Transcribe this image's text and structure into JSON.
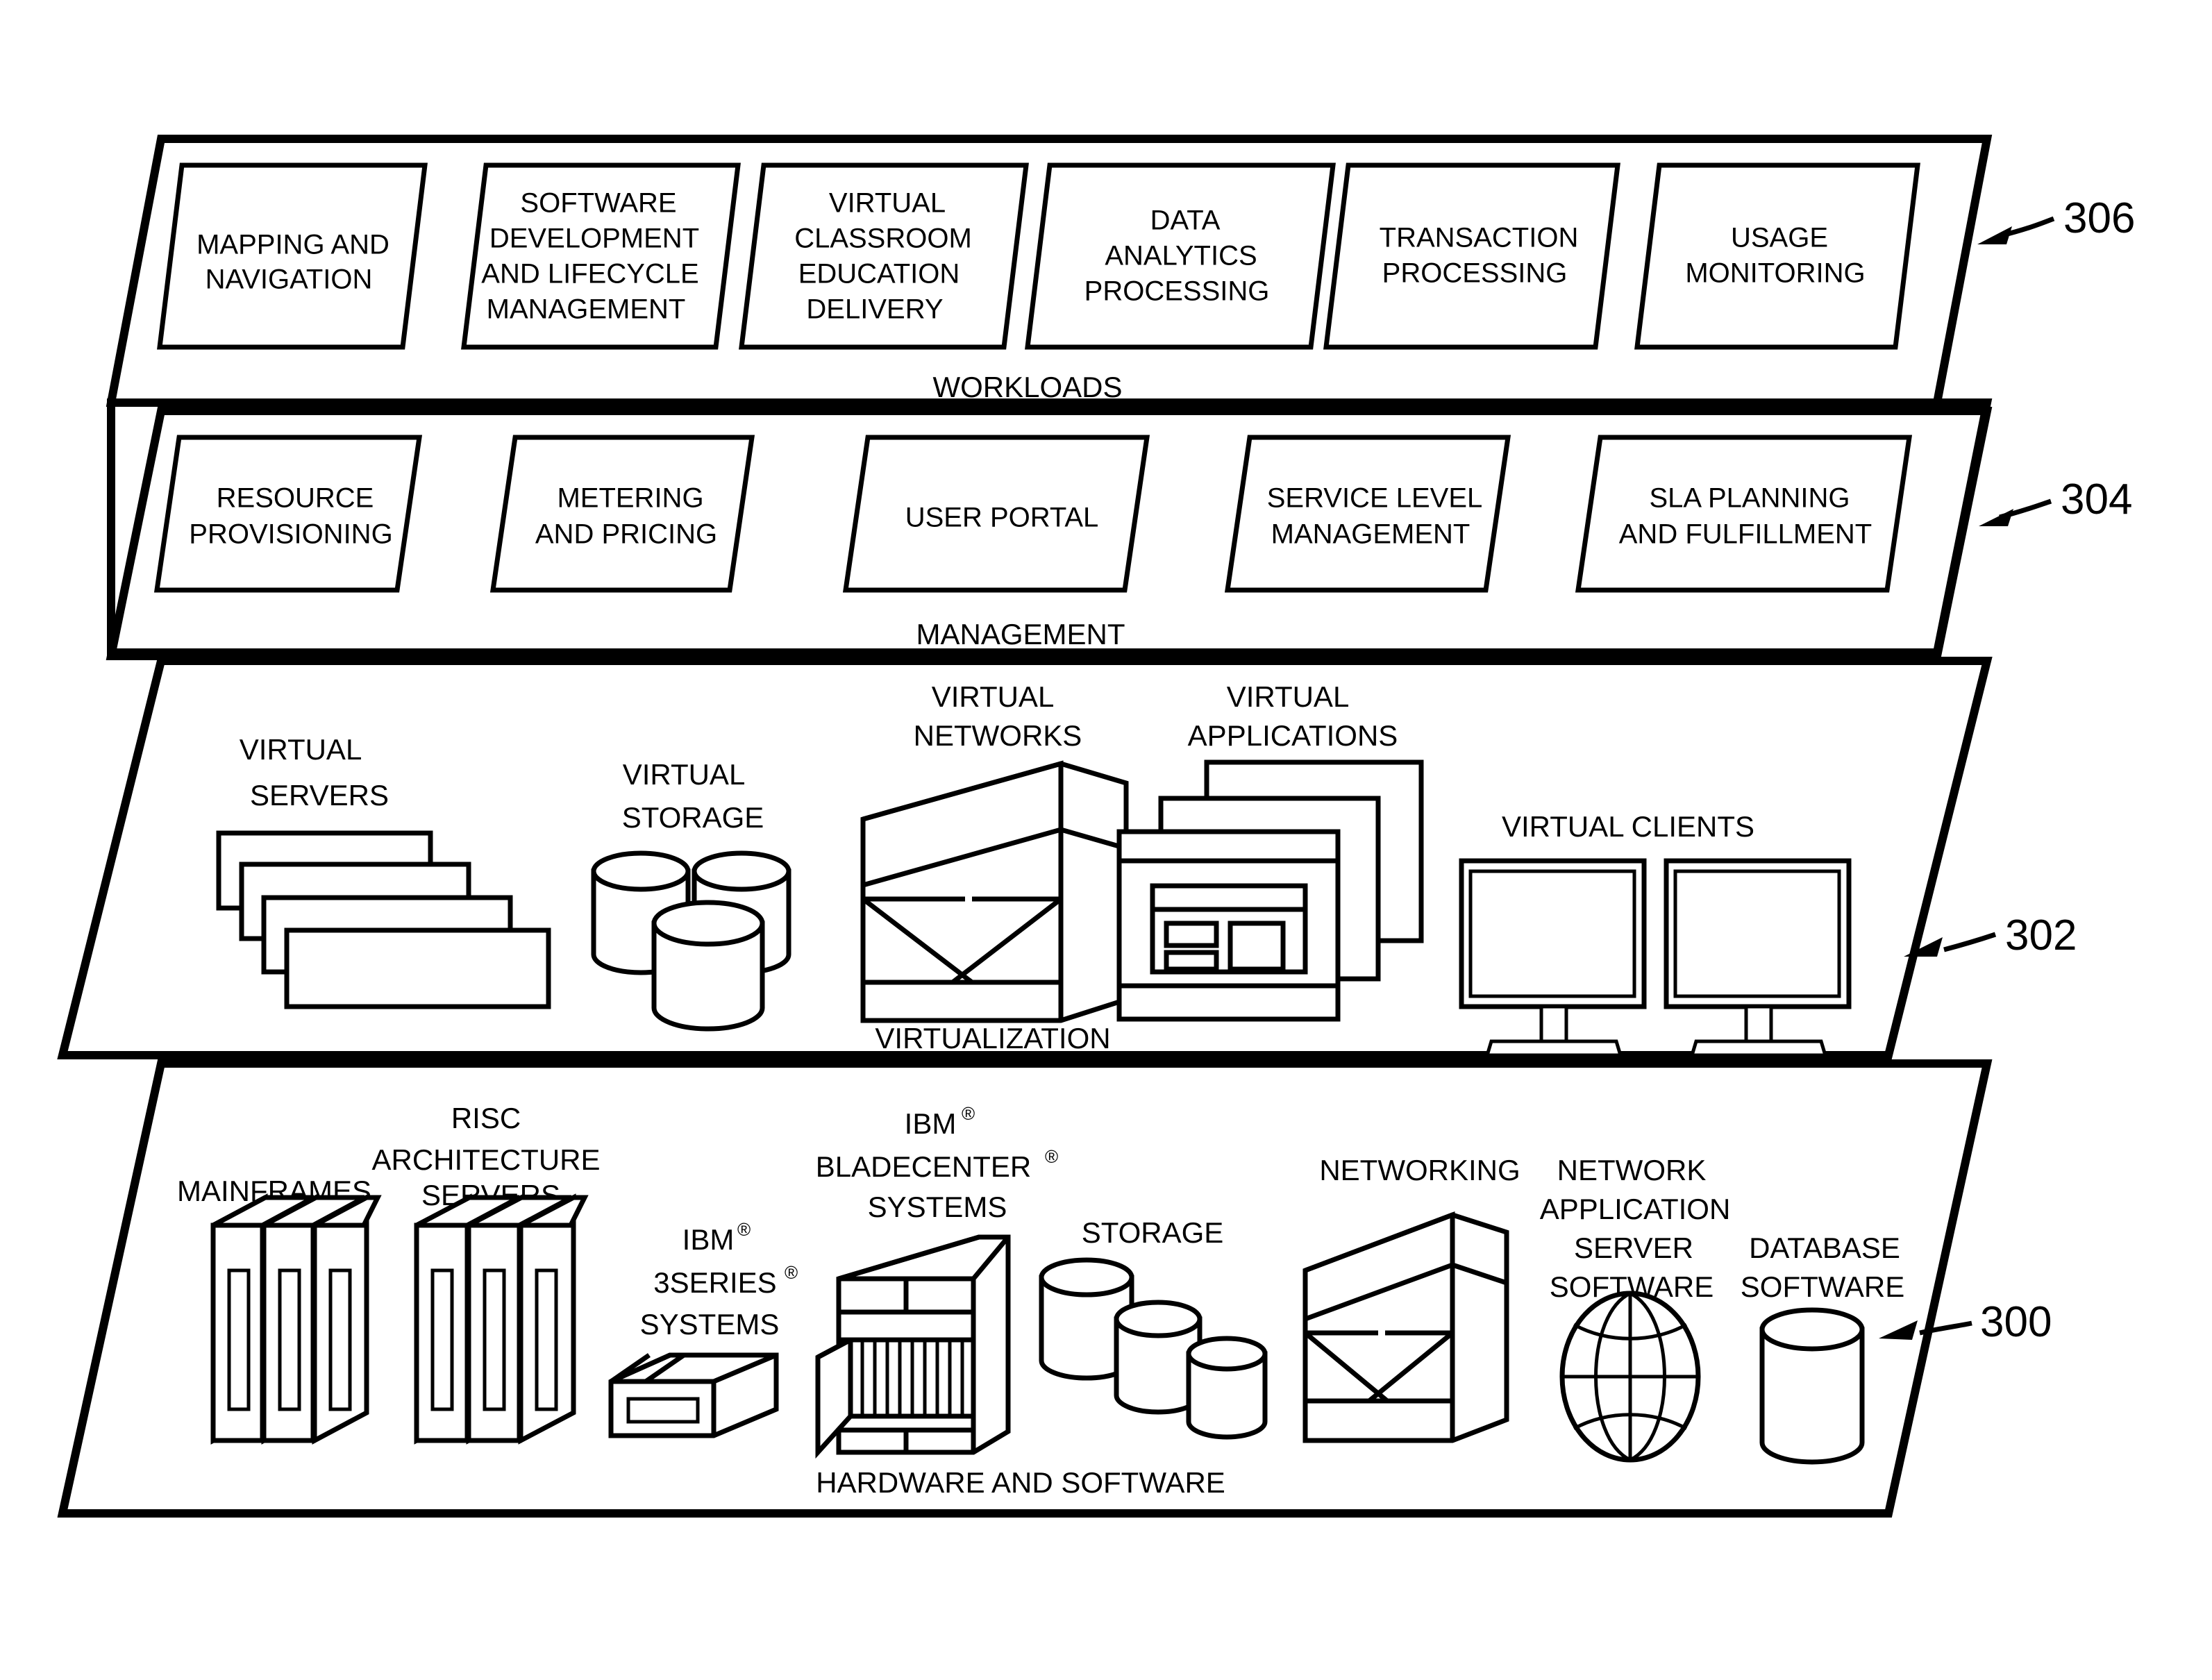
{
  "figure": {
    "type": "cloud-computing-abstraction-layers",
    "description": "Patent figure showing four stacked parallelogram abstraction layers"
  },
  "layers": [
    {
      "id": "workloads",
      "label": "WORKLOADS",
      "ref": "306",
      "boxes": [
        {
          "lines": [
            "MAPPING AND",
            "NAVIGATION"
          ]
        },
        {
          "lines": [
            "SOFTWARE",
            "DEVELOPMENT",
            "AND LIFECYCLE",
            "MANAGEMENT"
          ]
        },
        {
          "lines": [
            "VIRTUAL",
            "CLASSROOM",
            "EDUCATION",
            "DELIVERY"
          ]
        },
        {
          "lines": [
            "DATA",
            "ANALYTICS",
            "PROCESSING"
          ]
        },
        {
          "lines": [
            "TRANSACTION",
            "PROCESSING"
          ]
        },
        {
          "lines": [
            "USAGE",
            "MONITORING"
          ]
        }
      ]
    },
    {
      "id": "management",
      "label": "MANAGEMENT",
      "ref": "304",
      "boxes": [
        {
          "lines": [
            "RESOURCE",
            "PROVISIONING"
          ]
        },
        {
          "lines": [
            "METERING",
            "AND PRICING"
          ]
        },
        {
          "lines": [
            "USER PORTAL"
          ]
        },
        {
          "lines": [
            "SERVICE LEVEL",
            "MANAGEMENT"
          ]
        },
        {
          "lines": [
            "SLA PLANNING",
            "AND FULFILLMENT"
          ]
        }
      ]
    },
    {
      "id": "virtualization",
      "label": "VIRTUALIZATION",
      "ref": "302",
      "items": [
        {
          "icon": "virtual-servers-icon",
          "lines": [
            "VIRTUAL",
            "SERVERS"
          ]
        },
        {
          "icon": "virtual-storage-icon",
          "lines": [
            "VIRTUAL",
            "STORAGE"
          ]
        },
        {
          "icon": "virtual-networks-icon",
          "lines": [
            "VIRTUAL",
            "NETWORKS"
          ]
        },
        {
          "icon": "virtual-applications-icon",
          "lines": [
            "VIRTUAL",
            "APPLICATIONS"
          ]
        },
        {
          "icon": "virtual-clients-icon",
          "lines": [
            "VIRTUAL CLIENTS"
          ]
        }
      ]
    },
    {
      "id": "hardware-and-software",
      "label": "HARDWARE AND SOFTWARE",
      "ref": "300",
      "items": [
        {
          "icon": "mainframes-icon",
          "lines": [
            "MAINFRAMES"
          ]
        },
        {
          "icon": "risc-servers-icon",
          "lines": [
            "RISC",
            "ARCHITECTURE",
            "SERVERS"
          ]
        },
        {
          "icon": "ibm-3series-icon",
          "lines": [
            "IBM ®",
            "3SERIES ®",
            "SYSTEMS"
          ],
          "plain": [
            "IBM",
            "3SERIES",
            "SYSTEMS"
          ]
        },
        {
          "icon": "ibm-bladecenter-icon",
          "lines": [
            "IBM ®",
            "BLADECENTER ®",
            "SYSTEMS"
          ],
          "plain": [
            "IBM",
            "BLADECENTER",
            "SYSTEMS"
          ]
        },
        {
          "icon": "storage-icon",
          "lines": [
            "STORAGE"
          ]
        },
        {
          "icon": "networking-icon",
          "lines": [
            "NETWORKING"
          ]
        },
        {
          "icon": "network-app-server-software-icon",
          "lines": [
            "NETWORK",
            "APPLICATION",
            "SERVER",
            "SOFTWARE"
          ]
        },
        {
          "icon": "database-software-icon",
          "lines": [
            "DATABASE",
            "SOFTWARE"
          ]
        }
      ]
    }
  ],
  "trademark_symbol": "®",
  "colors": {
    "line": "#000000",
    "background": "#ffffff"
  }
}
